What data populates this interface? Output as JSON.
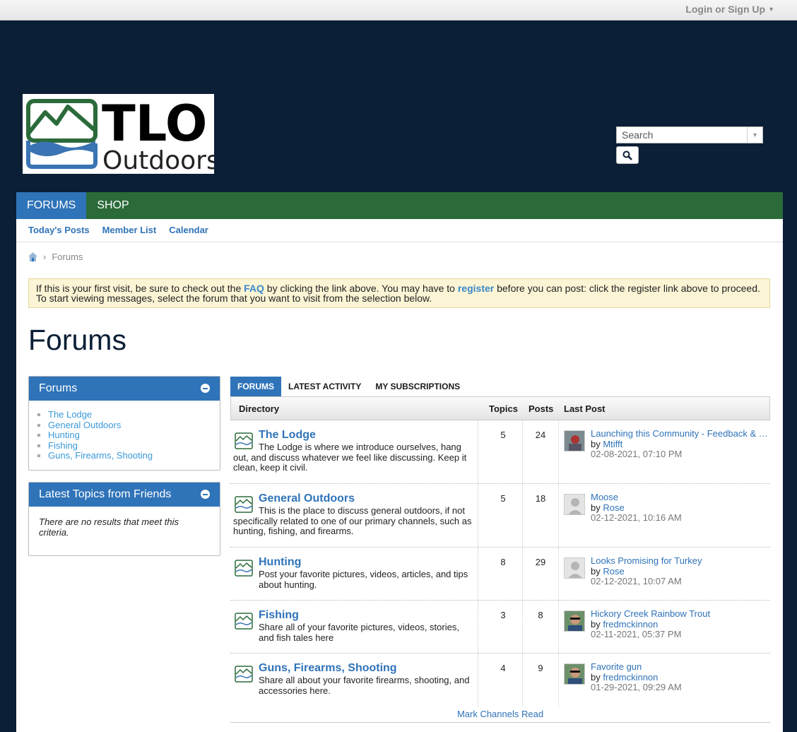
{
  "topbar": {
    "login_label": "Login or Sign Up"
  },
  "logo": {
    "line1": "TLO",
    "line2": "Outdoors"
  },
  "search": {
    "placeholder": "Search"
  },
  "mainnav": {
    "forums": "FORUMS",
    "shop": "SHOP"
  },
  "subnav": {
    "todays_posts": "Today's Posts",
    "member_list": "Member List",
    "calendar": "Calendar"
  },
  "breadcrumb": {
    "current": "Forums"
  },
  "notice": {
    "text1": "If this is your first visit, be sure to check out the ",
    "faq": "FAQ",
    "text2": " by clicking the link above. You may have to ",
    "register": "register",
    "text3": " before you can post: click the register link above to proceed. To start viewing messages, select the forum that you want to visit from the selection below."
  },
  "page_title": "Forums",
  "sidebar": {
    "forums_title": "Forums",
    "forums": [
      "The Lodge",
      "General Outdoors",
      "Hunting",
      "Fishing",
      "Guns, Firearms, Shooting"
    ],
    "friends_title": "Latest Topics from Friends",
    "friends_empty": "There are no results that meet this criteria."
  },
  "tabs": {
    "forums": "FORUMS",
    "latest_activity": "LATEST ACTIVITY",
    "subscriptions": "MY SUBSCRIPTIONS"
  },
  "table": {
    "headers": {
      "directory": "Directory",
      "topics": "Topics",
      "posts": "Posts",
      "last_post": "Last Post"
    },
    "rows": [
      {
        "title": "The Lodge",
        "desc": "The Lodge is where we introduce ourselves, hang out, and discuss whatever we feel like discussing. Keep it clean, keep it civil.",
        "topics": "5",
        "posts": "24",
        "last_title": "Launching this Community - Feedback & Welcome",
        "by": "by ",
        "author": "Mtifft",
        "date": "02-08-2021, 07:10 PM"
      },
      {
        "title": "General Outdoors",
        "desc": "This is the place to discuss general outdoors, if not specifically related to one of our primary channels, such as hunting, fishing, and firearms.",
        "topics": "5",
        "posts": "18",
        "last_title": "Moose",
        "by": "by ",
        "author": "Rose",
        "date": "02-12-2021, 10:16 AM"
      },
      {
        "title": "Hunting",
        "desc": "Post your favorite pictures, videos, articles, and tips about hunting.",
        "topics": "8",
        "posts": "29",
        "last_title": "Looks Promising for Turkey",
        "by": "by ",
        "author": "Rose",
        "date": "02-12-2021, 10:07 AM"
      },
      {
        "title": "Fishing",
        "desc": "Share all of your favorite pictures, videos, stories, and fish tales here",
        "topics": "3",
        "posts": "8",
        "last_title": "Hickory Creek Rainbow Trout",
        "by": "by ",
        "author": "fredmckinnon",
        "date": "02-11-2021, 05:37 PM"
      },
      {
        "title": "Guns, Firearms, Shooting",
        "desc": "Share all about your favorite firearms, shooting, and accessories here.",
        "topics": "4",
        "posts": "9",
        "last_title": "Favorite gun",
        "by": "by ",
        "author": "fredmckinnon",
        "date": "01-29-2021, 09:29 AM"
      }
    ]
  },
  "mark_read": "Mark Channels Read",
  "colors": {
    "navy": "#0b1f36",
    "green": "#2b6b3a",
    "blue": "#2f73b8",
    "notice": "#fbf5d6"
  }
}
